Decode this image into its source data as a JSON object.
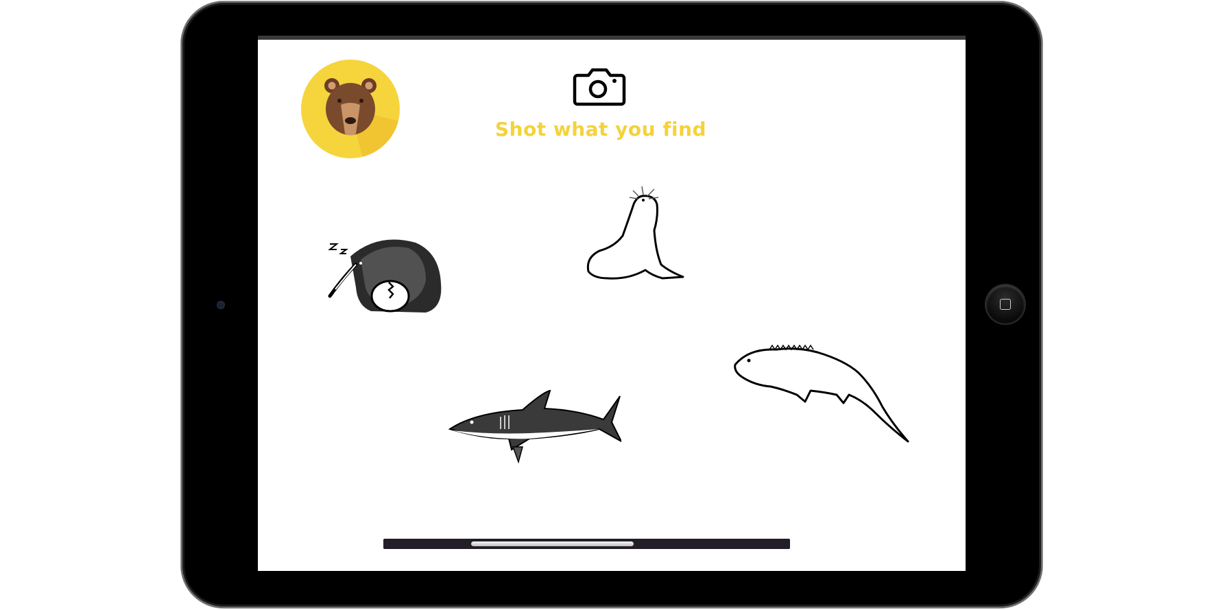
{
  "app": {
    "caption": "Shot what you find",
    "accent_color": "#f4d23a",
    "logo_icon": "bear-face-icon",
    "camera_icon": "camera-icon"
  },
  "animals": [
    {
      "name": "kiwi",
      "icon": "kiwi-bird-illustration"
    },
    {
      "name": "seal",
      "icon": "seal-illustration"
    },
    {
      "name": "shark",
      "icon": "shark-illustration"
    },
    {
      "name": "tuatara",
      "icon": "tuatara-illustration"
    }
  ],
  "scrollbar": {
    "position_fraction": 0.36,
    "thumb_fraction": 0.4
  },
  "device": {
    "type": "tablet-landscape",
    "home_button_icon": "home-square-icon"
  }
}
